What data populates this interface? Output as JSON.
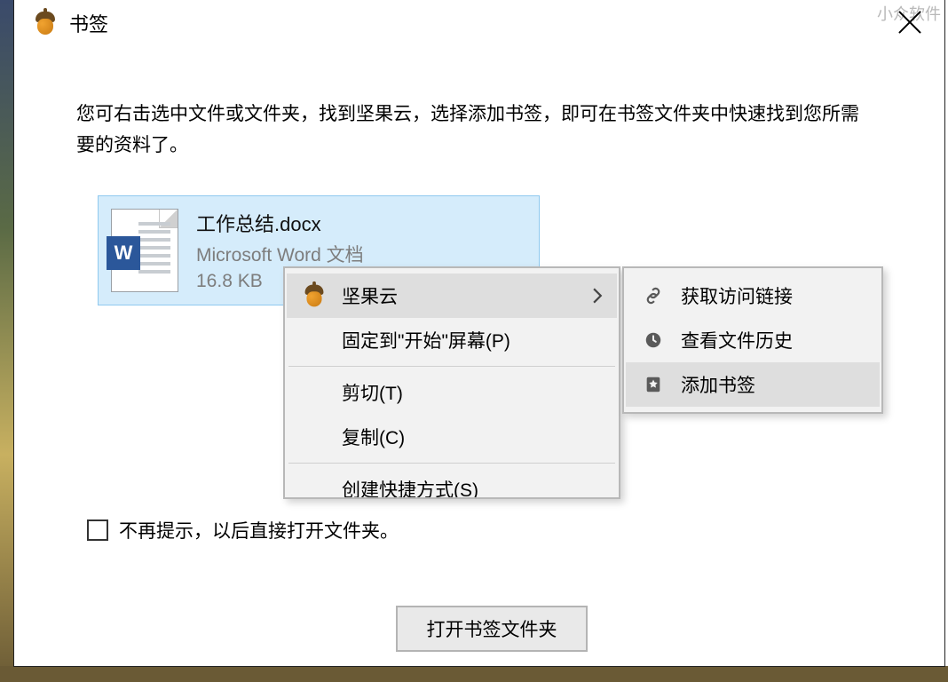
{
  "watermark": "小众软件",
  "window": {
    "title": "书签"
  },
  "instruction": "您可右击选中文件或文件夹，找到坚果云，选择添加书签，即可在书签文件夹中快速找到您所需要的资料了。",
  "file": {
    "name": "工作总结.docx",
    "type": "Microsoft Word 文档",
    "size": "16.8 KB",
    "icon_letter": "W"
  },
  "context_menu": {
    "nutstore": "坚果云",
    "pin_to_start": "固定到\"开始\"屏幕(P)",
    "cut": "剪切(T)",
    "copy": "复制(C)",
    "create_shortcut": "创建快捷方式(S)"
  },
  "submenu": {
    "get_link": "获取访问链接",
    "view_history": "查看文件历史",
    "add_bookmark": "添加书签"
  },
  "checkbox_label": "不再提示，以后直接打开文件夹。",
  "open_button": "打开书签文件夹"
}
